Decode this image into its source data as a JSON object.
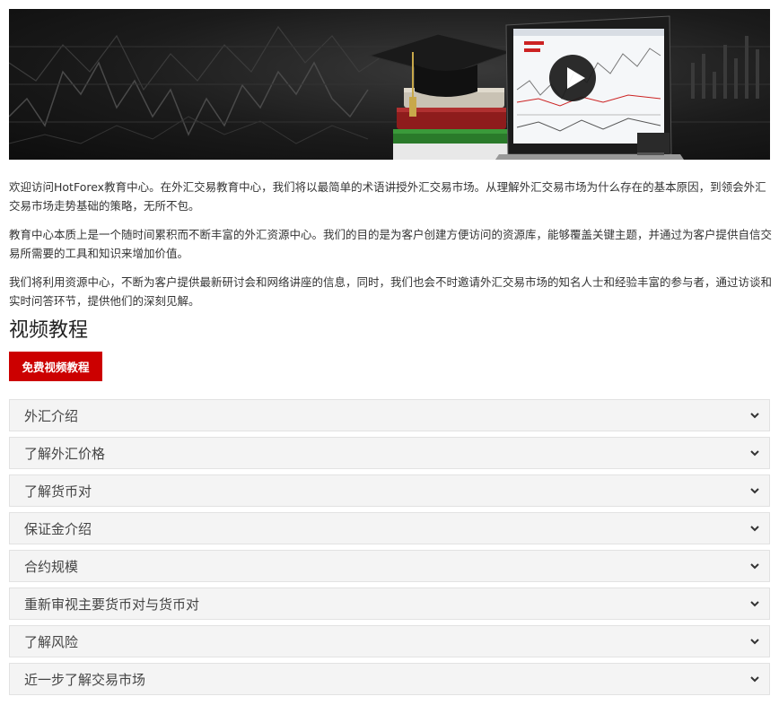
{
  "banner": {
    "laptop_screen_title": "",
    "play_icon": "play-icon",
    "colors": {
      "background": "#1b1b1b",
      "books": [
        "#b8b0a0",
        "#8e1c1c",
        "#2a7a2a"
      ],
      "cap": "#141414",
      "tassel": "#c8a84a"
    }
  },
  "intro": {
    "p1": "欢迎访问HotForex教育中心。在外汇交易教育中心，我们将以最简单的术语讲授外汇交易市场。从理解外汇交易市场为什么存在的基本原因，到领会外汇交易市场走势基础的策略，无所不包。",
    "p2": "教育中心本质上是一个随时间累积而不断丰富的外汇资源中心。我们的目的是为客户创建方便访问的资源库，能够覆盖关键主题，并通过为客户提供自信交易所需要的工具和知识来增加价值。",
    "p3": "我们将利用资源中心，不断为客户提供最新研讨会和网络讲座的信息，同时，我们也会不时邀请外汇交易市场的知名人士和经验丰富的参与者，通过访谈和实时问答环节，提供他们的深刻见解。"
  },
  "video_section": {
    "title": "视频教程",
    "button_label": "免费视频教程",
    "button_color": "#cc0000"
  },
  "accordion": {
    "items": [
      {
        "label": "外汇介绍"
      },
      {
        "label": "了解外汇价格"
      },
      {
        "label": "了解货币对"
      },
      {
        "label": "保证金介绍"
      },
      {
        "label": "合约规模"
      },
      {
        "label": "重新审视主要货币对与货币对"
      },
      {
        "label": "了解风险"
      },
      {
        "label": "近一步了解交易市场"
      }
    ],
    "chevron_icon": "chevron-down-icon"
  }
}
